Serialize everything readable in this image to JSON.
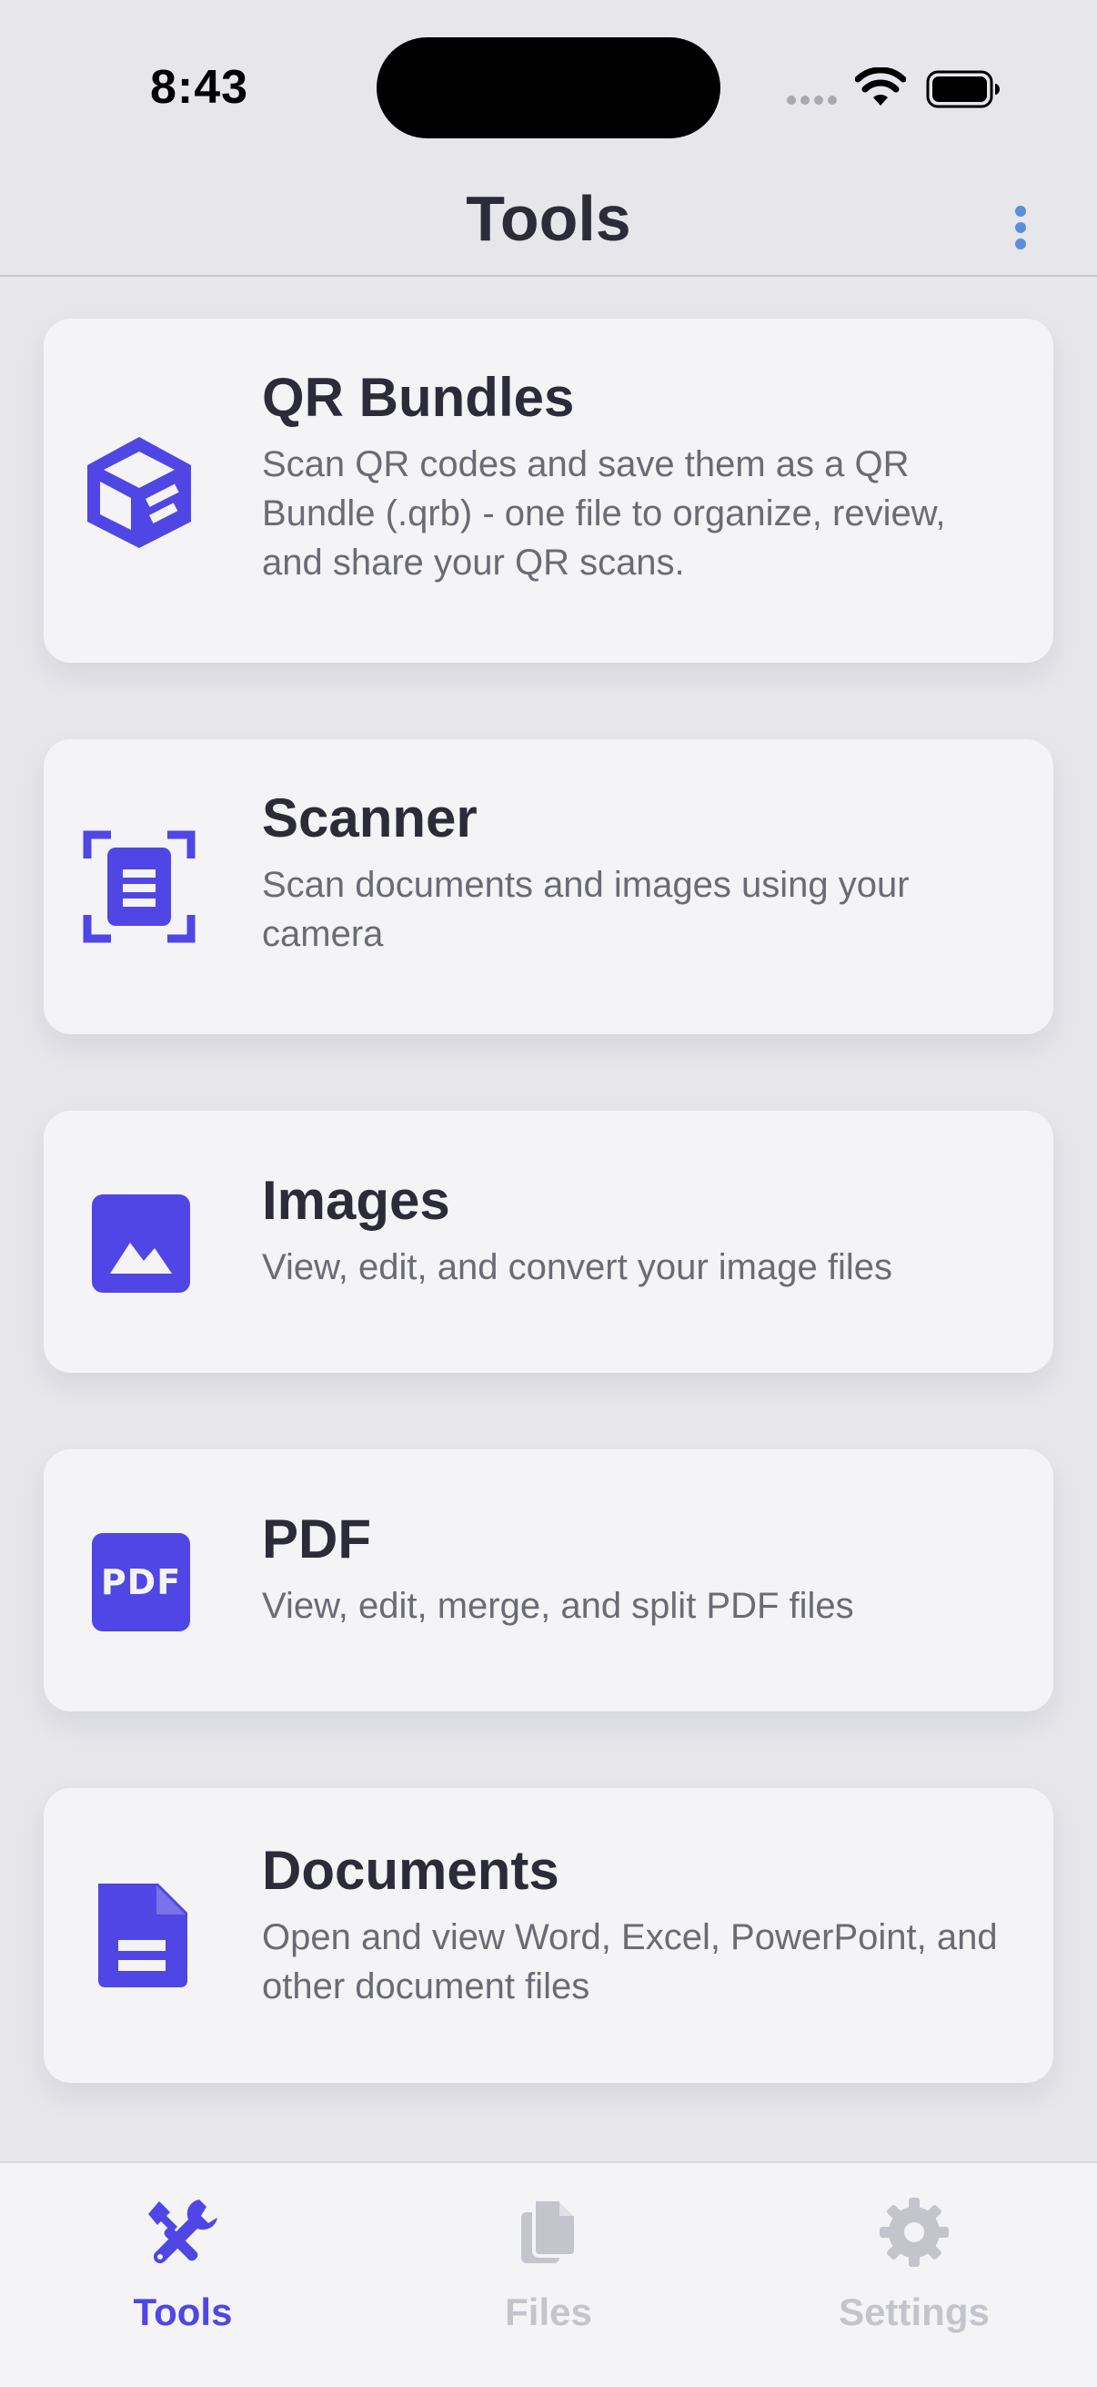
{
  "status_bar": {
    "time": "8:43"
  },
  "nav": {
    "title": "Tools"
  },
  "colors": {
    "accent": "#4f46e5",
    "inactive": "#c4c4cc",
    "text_primary": "#2c2c38",
    "text_secondary": "#6b6b75"
  },
  "tools": [
    {
      "icon": "qr-bundle-box-icon",
      "title": "QR Bundles",
      "description": "Scan QR codes and save them as a QR Bundle (.qrb) - one file to organize, review, and share your QR scans."
    },
    {
      "icon": "document-scanner-icon",
      "title": "Scanner",
      "description": "Scan documents and images using your camera"
    },
    {
      "icon": "image-icon",
      "title": "Images",
      "description": "View, edit, and convert your image files"
    },
    {
      "icon": "pdf-icon",
      "title": "PDF",
      "pdf_badge": "PDF",
      "description": "View, edit, merge, and split PDF files"
    },
    {
      "icon": "document-icon",
      "title": "Documents",
      "description": "Open and view Word, Excel, PowerPoint, and other document files"
    }
  ],
  "tab_bar": {
    "selected": "Tools",
    "tabs": [
      {
        "label": "Tools",
        "icon": "tools-icon"
      },
      {
        "label": "Files",
        "icon": "files-icon"
      },
      {
        "label": "Settings",
        "icon": "settings-icon"
      }
    ]
  }
}
